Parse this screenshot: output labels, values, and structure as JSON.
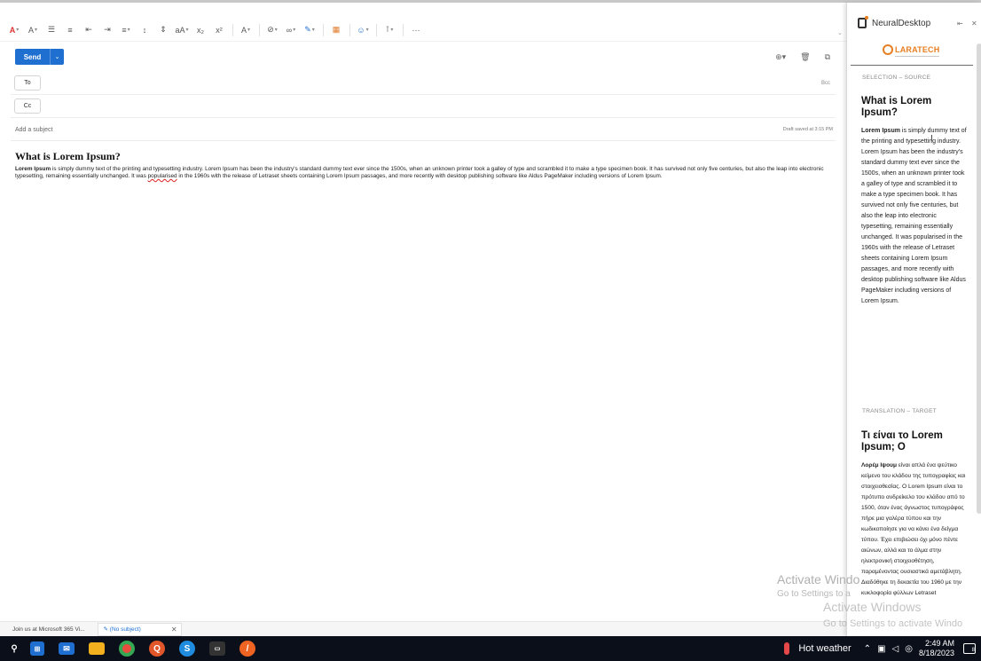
{
  "toolbar": {
    "icons": [
      "font-color-icon",
      "highlight-icon",
      "bullets-icon",
      "numbering-icon",
      "decrease-indent-icon",
      "increase-indent-icon",
      "align-icon",
      "line-spacing-icon",
      "paragraph-spacing-icon",
      "font-size-icon",
      "subscript-icon",
      "superscript-icon",
      "styles-icon",
      "link-icon",
      "infinity-icon",
      "draw-icon",
      "table-icon",
      "emoji-icon",
      "attach-icon",
      "more-icon"
    ],
    "more_label": "···"
  },
  "send": {
    "label": "Send",
    "dropdown": "⌄"
  },
  "fields": {
    "to_label": "To",
    "cc_label": "Cc",
    "bcc_label": "Bcc",
    "subject_placeholder": "Add a subject",
    "draft_saved": "Draft saved at 3:15 PM"
  },
  "body": {
    "title": "What is Lorem Ipsum?",
    "bold_lead": "Lorem Ipsum",
    "text_part1": " is simply dummy text of the printing and typesetting industry. Lorem Ipsum has been the industry's standard dummy text ever since the 1500s, when an unknown printer took a galley of type and scrambled it to make a type specimen book. It has survived not only five centuries, but also the leap into electronic typesetting, remaining essentially unchanged. It was ",
    "misspelled": "popularised",
    "text_part2": " in the 1960s with the release of Letraset sheets containing Lorem Ipsum passages, and more recently with desktop publishing software like Aldus PageMaker including versions of Lorem Ipsum."
  },
  "draft_tabs": [
    {
      "label": "Join us at Microsoft 365 Vi..."
    },
    {
      "label": "✎ (No subject)",
      "close": "✕"
    }
  ],
  "panel": {
    "title": "NeuralDesktop",
    "pin": "⇤",
    "close": "✕",
    "logo_text": "LARATECH",
    "source_label": "SELECTION – SOURCE",
    "source_title": "What is Lorem Ipsum?",
    "source_bold": "Lorem Ipsum",
    "source_text": " is simply dummy text of the printing and typesetting industry. Lorem Ipsum has been the industry's standard dummy text ever since the 1500s, when an unknown printer took a galley of type and scrambled it to make a type specimen book. It has survived not only five centuries, but also the leap into electronic typesetting, remaining essentially unchanged. It was popularised in the 1960s with the release of Letraset sheets containing Lorem Ipsum passages, and more recently with desktop publishing software like Aldus PageMaker including versions of Lorem Ipsum.",
    "target_label": "TRANSLATION – TARGET",
    "target_title": "Τι είναι το Lorem Ipsum; Ο",
    "target_bold": "Λορέμ Ιψουμ",
    "target_text": " είναι απλά ένα ψεύτικο κείμενο του κλάδου της τυπογραφίας και στοιχειοθεσίας. Ο Lorem Ipsum είναι το πρότυπο ανδρείκελο του κλάδου από το 1500, όταν ένας άγνωστος τυπογράφος πήρε μια γαλέρα τύπου και την κωδικοποίησε για να κάνει ένα δείγμα τύπου. Έχει επιβιώσει όχι μόνο πέντε αιώνων, αλλά και το άλμα στην ηλεκτρονική στοιχειοθέτηση, παραμένοντας ουσιαστικά αμετάβλητη. Διαδόθηκε τη δεκαετία του 1960 με την κυκλοφορία φύλλων Letraset"
  },
  "watermark": {
    "line1": "Activate Windo",
    "line2": "Go to Settings to a",
    "line3": "Activate Windows",
    "line4": "Go to Settings to activate Windo"
  },
  "taskbar": {
    "weather": "Hot weather",
    "time": "2:49 AM",
    "date": "8/18/2023",
    "notif_count": "8"
  }
}
